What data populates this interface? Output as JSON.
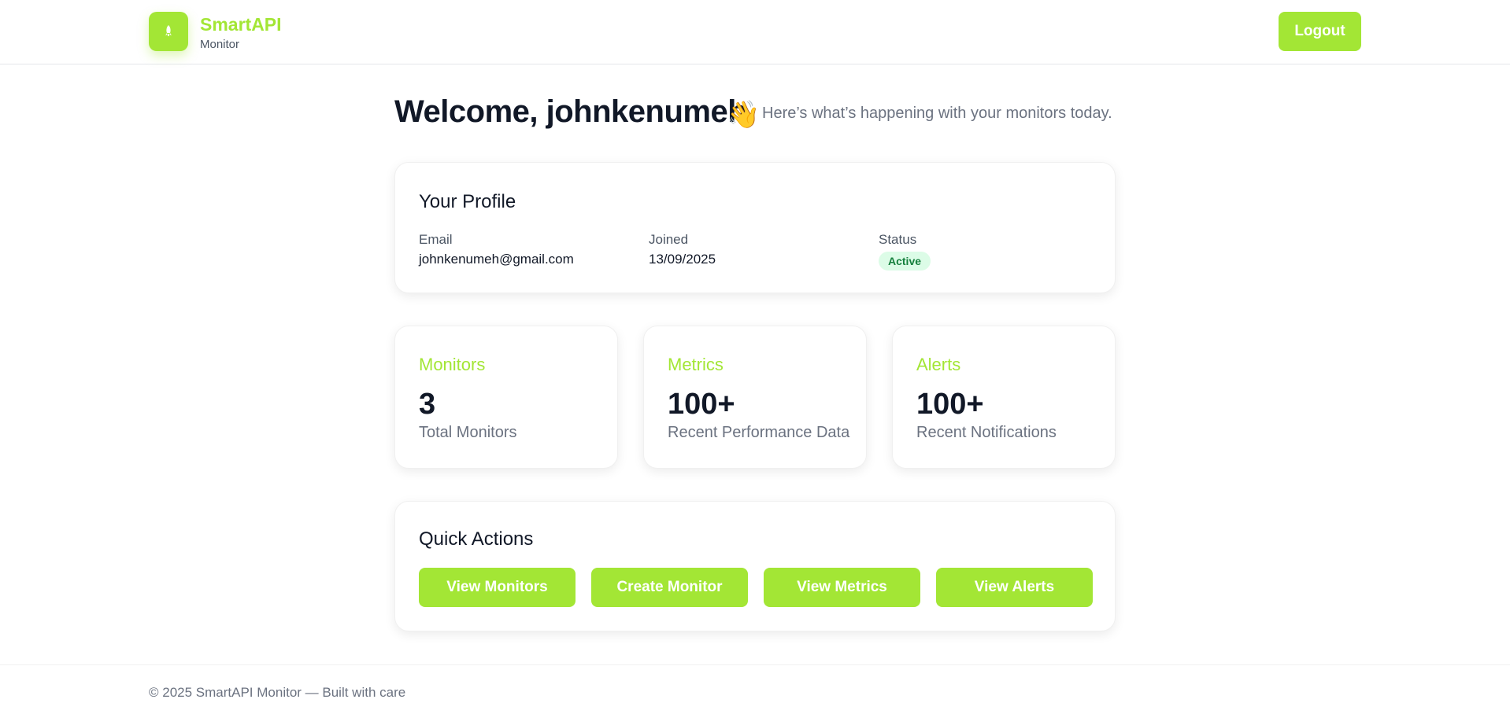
{
  "header": {
    "brand_name": "SmartAPI",
    "brand_sub": "Monitor",
    "logout_label": "Logout",
    "logo_icon": "rocket-icon",
    "accent_color": "#a3e635"
  },
  "welcome": {
    "title": "Welcome, johnkenumeh",
    "wave_icon": "👋",
    "subtitle": "Here’s what’s happening with your monitors today."
  },
  "profile": {
    "title": "Your Profile",
    "email_label": "Email",
    "email_value": "johnkenumeh@gmail.com",
    "joined_label": "Joined",
    "joined_value": "13/09/2025",
    "status_label": "Status",
    "status_value": "Active"
  },
  "stats": [
    {
      "title": "Monitors",
      "value": "3",
      "desc": "Total Monitors"
    },
    {
      "title": "Metrics",
      "value": "100+",
      "desc": "Recent Performance Data"
    },
    {
      "title": "Alerts",
      "value": "100+",
      "desc": "Recent Notifications"
    }
  ],
  "actions": {
    "title": "Quick Actions",
    "buttons": [
      "View Monitors",
      "Create Monitor",
      "View Metrics",
      "View Alerts"
    ]
  },
  "footer": {
    "text": "© 2025 SmartAPI Monitor — Built with care"
  }
}
